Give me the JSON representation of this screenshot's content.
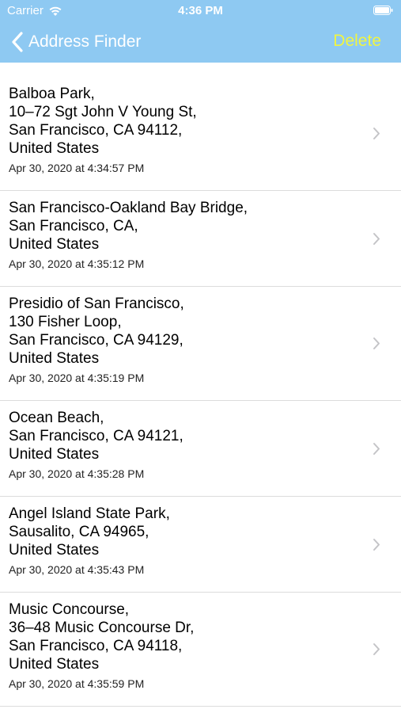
{
  "status_bar": {
    "carrier": "Carrier",
    "time": "4:36 PM"
  },
  "nav": {
    "back_label": "Address Finder",
    "delete_label": "Delete",
    "header_color": "#8ec9f2",
    "delete_color": "#f0f542"
  },
  "locations": [
    {
      "lines": [
        "Balboa Park,",
        "10–72 Sgt John V Young St,",
        "San Francisco, CA  94112,",
        "United States"
      ],
      "timestamp": "Apr 30, 2020 at 4:34:57 PM"
    },
    {
      "lines": [
        "San Francisco-Oakland Bay Bridge,",
        "San Francisco, CA,",
        "United States"
      ],
      "timestamp": "Apr 30, 2020 at 4:35:12 PM"
    },
    {
      "lines": [
        "Presidio of San Francisco,",
        "130 Fisher Loop,",
        "San Francisco, CA  94129,",
        "United States"
      ],
      "timestamp": "Apr 30, 2020 at 4:35:19 PM"
    },
    {
      "lines": [
        "Ocean Beach,",
        "San Francisco, CA  94121,",
        "United States"
      ],
      "timestamp": "Apr 30, 2020 at 4:35:28 PM"
    },
    {
      "lines": [
        "Angel Island State Park,",
        "Sausalito, CA  94965,",
        "United States"
      ],
      "timestamp": "Apr 30, 2020 at 4:35:43 PM"
    },
    {
      "lines": [
        "Music Concourse,",
        "36–48 Music Concourse Dr,",
        "San Francisco, CA  94118,",
        "United States"
      ],
      "timestamp": "Apr 30, 2020 at 4:35:59 PM"
    }
  ]
}
